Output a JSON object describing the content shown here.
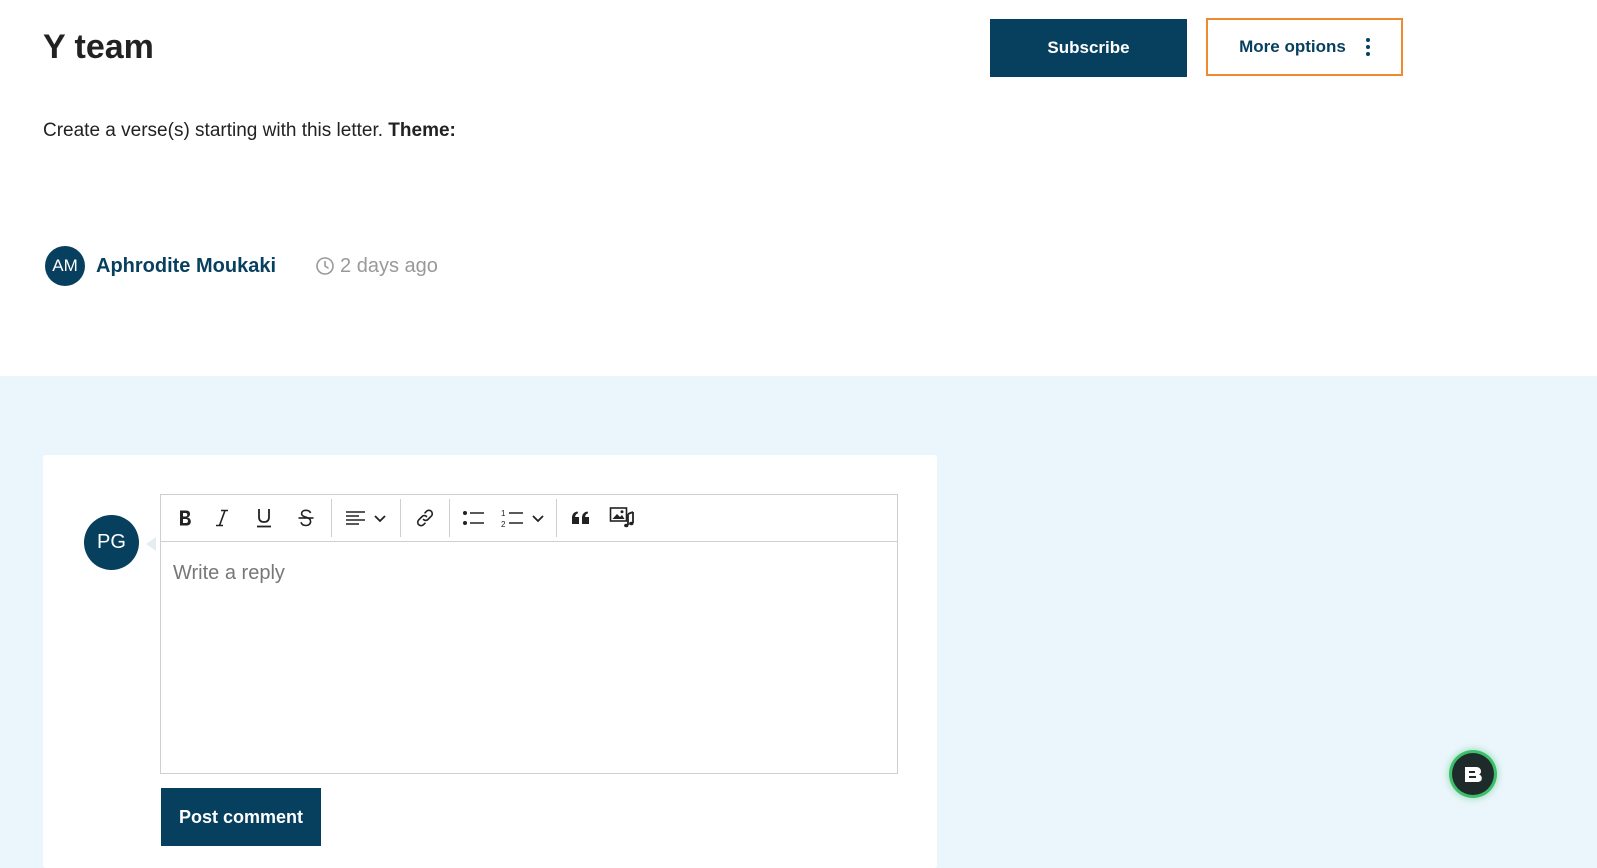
{
  "header": {
    "title": "Y team",
    "subscribe_label": "Subscribe",
    "more_options_label": "More options"
  },
  "description": {
    "text": "Create a verse(s) starting with this letter.",
    "theme_label": "Theme:"
  },
  "author": {
    "initials": "AM",
    "name": "Aphrodite Moukaki",
    "time": "2 days ago"
  },
  "reply": {
    "user_initials": "PG",
    "placeholder": "Write a reply",
    "post_label": "Post comment"
  },
  "toolbar_icons": [
    "bold-icon",
    "italic-icon",
    "underline-icon",
    "strikethrough-icon",
    "align-left-icon",
    "chevron-down-icon",
    "link-icon",
    "bullet-list-icon",
    "numbered-list-icon",
    "chevron-down-icon",
    "blockquote-icon",
    "media-icon"
  ],
  "colors": {
    "primary": "#073f5f",
    "accent_border": "#ef8b2e",
    "lower_background": "#ebf6fc",
    "widget_glow": "#3cbf6a"
  }
}
